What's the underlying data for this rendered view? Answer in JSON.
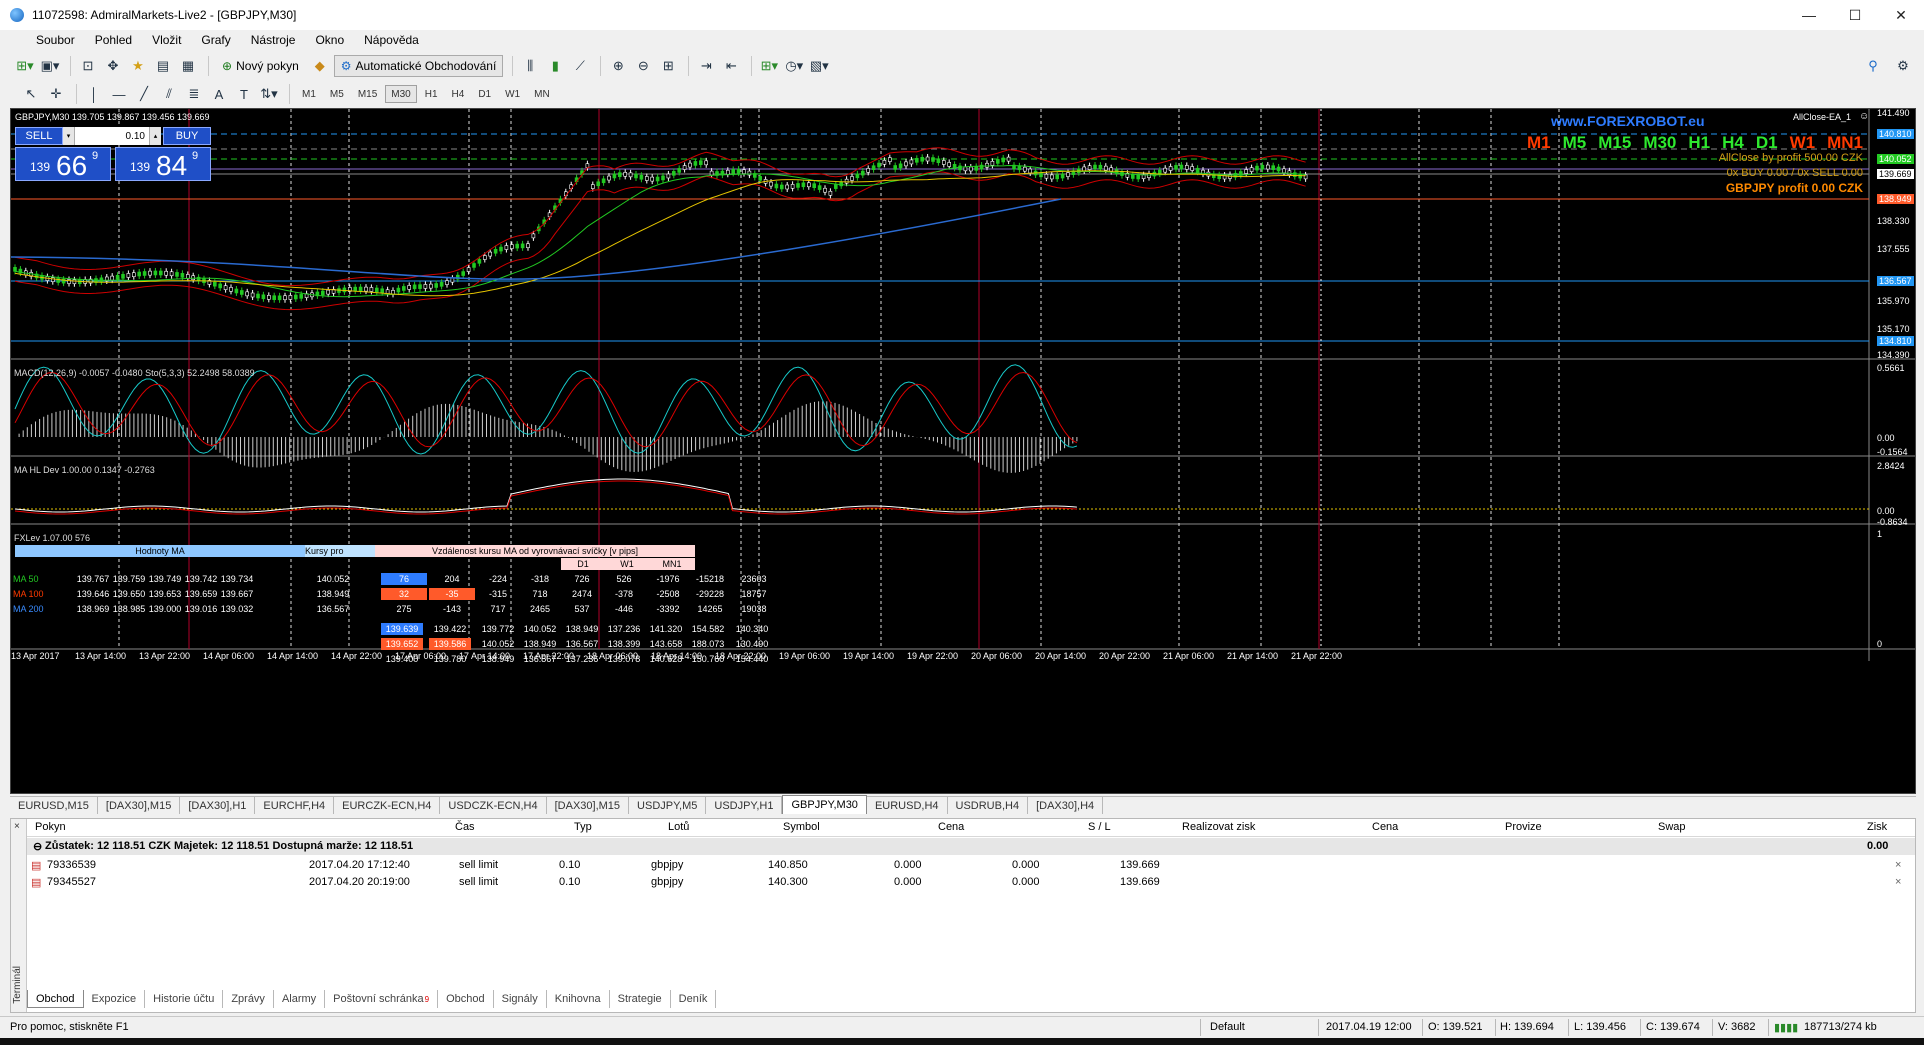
{
  "window": {
    "title": "11072598: AdmiralMarkets-Live2 - [GBPJPY,M30]",
    "controls": {
      "minimize": "—",
      "maximize": "☐",
      "close": "✕"
    }
  },
  "menu": [
    "Soubor",
    "Pohled",
    "Vložit",
    "Grafy",
    "Nástroje",
    "Okno",
    "Nápověda"
  ],
  "toolbar": {
    "new_order": "Nový pokyn",
    "auto_trading": "Automatické Obchodování",
    "timeframes": [
      "M1",
      "M5",
      "M15",
      "M30",
      "H1",
      "H4",
      "D1",
      "W1",
      "MN"
    ],
    "active_timeframe": "M30"
  },
  "chart": {
    "header": "GBPJPY,M30  139.705 139.867 139.456 139.669",
    "ea_label": "AllClose-EA_1",
    "site": "www.FOREXROBOT.eu",
    "oneclick": {
      "sell": "SELL",
      "buy": "BUY",
      "lot": "0.10",
      "bid_small": "139",
      "bid_big": "66",
      "bid_sup": "9",
      "ask_small": "139",
      "ask_big": "84",
      "ask_sup": "9"
    },
    "tf_strip": [
      "M1",
      "M5",
      "M15",
      "M30",
      "H1",
      "H4",
      "D1",
      "W1",
      "MN1"
    ],
    "tf_strip_colors": [
      "#ff3a00",
      "#2ee82e",
      "#2ee82e",
      "#2ee82e",
      "#2ee82e",
      "#2ee82e",
      "#2ee82e",
      "#ff3a00",
      "#ff3a00"
    ],
    "allclose_line1": "AllClose by profit 500.00 CZK",
    "allclose_line2": "0x BUY 0.00 / 0x SELL 0.00",
    "allclose_line3": "GBPJPY profit 0.00 CZK",
    "price_axis": [
      "141.490",
      "140.810",
      "140.052",
      "139.669",
      "138.949",
      "138.330",
      "137.555",
      "136.567",
      "135.970",
      "135.170",
      "134.810",
      "134.390"
    ],
    "macd_label": "MACD(12,26,9) -0.0057 -0.0480  Sto(5,3,3) 52.2498 58.0389",
    "macd_axis": [
      "0.5661",
      "0.00",
      "-0.1564"
    ],
    "mahl_label": "MA HL Dev 1.00.00 0.1347 -0.2763",
    "mahl_axis": [
      "2.8424",
      "0.00",
      "-0.8634"
    ],
    "fxlev_label": "FXLev 1.07.00 576",
    "fxlev_axis": [
      "1",
      "0"
    ],
    "time_axis": [
      "13 Apr 2017",
      "13 Apr 14:00",
      "13 Apr 22:00",
      "14 Apr 06:00",
      "14 Apr 14:00",
      "14 Apr 22:00",
      "17 Apr 06:00",
      "17 Apr 14:00",
      "17 Apr 22:00",
      "18 Apr 06:00",
      "18 Apr 14:00",
      "18 Apr 22:00",
      "19 Apr 06:00",
      "19 Apr 14:00",
      "19 Apr 22:00",
      "20 Apr 06:00",
      "20 Apr 14:00",
      "20 Apr 22:00",
      "21 Apr 06:00",
      "21 Apr 14:00",
      "21 Apr 22:00"
    ]
  },
  "fxlev": {
    "hdr_ma": "Hodnoty MA",
    "hdr_kurz": "Kursy pro",
    "hdr_vzd": "Vzdálenost kursu MA od vyrovnávací svíčky [v pips]",
    "hdr_d1": "D1",
    "hdr_w1": "W1",
    "hdr_mn1": "MN1",
    "rows": [
      {
        "name": "MA 50",
        "color": "#22c922",
        "vals": [
          "139.767",
          "139.759",
          "139.749",
          "139.742",
          "139.734"
        ],
        "kurz": "140.052",
        "c1": "76",
        "c2": "204",
        "d": [
          "-224",
          "-318",
          "726",
          "526",
          "-1976",
          "-15218",
          "23603"
        ]
      },
      {
        "name": "MA 100",
        "color": "#ff3a00",
        "vals": [
          "139.646",
          "139.650",
          "139.653",
          "139.659",
          "139.667"
        ],
        "kurz": "138.949",
        "c1": "32",
        "c2": "-35",
        "d": [
          "-315",
          "718",
          "2474",
          "-378",
          "-2508",
          "-29228",
          "18757"
        ]
      },
      {
        "name": "MA 200",
        "color": "#3a8cff",
        "vals": [
          "138.969",
          "138.985",
          "139.000",
          "139.016",
          "139.032"
        ],
        "kurz": "136.567",
        "c1": "275",
        "c2": "-143",
        "d": [
          "717",
          "2465",
          "537",
          "-446",
          "-3392",
          "14265",
          "19038"
        ]
      }
    ],
    "price_rows": [
      [
        "139.639",
        "139.422",
        "139.772",
        "140.052",
        "138.949",
        "137.236",
        "141.320",
        "154.582",
        "140.340"
      ],
      [
        "139.652",
        "139.586",
        "140.052",
        "138.949",
        "136.567",
        "138.399",
        "143.658",
        "188.073",
        "130.490"
      ],
      [
        "139.400",
        "139.780",
        "138.949",
        "136.567",
        "137.236",
        "139.078",
        "140.628",
        "150.760",
        "154.440"
      ]
    ]
  },
  "symbol_tabs": [
    "EURUSD,M15",
    "[DAX30],M15",
    "[DAX30],H1",
    "EURCHF,H4",
    "EURCZK-ECN,H4",
    "USDCZK-ECN,H4",
    "[DAX30],M15",
    "USDJPY,M5",
    "USDJPY,H1",
    "GBPJPY,M30",
    "EURUSD,H4",
    "USDRUB,H4",
    "[DAX30],H4"
  ],
  "active_symbol_tab": "GBPJPY,M30",
  "terminal": {
    "side_label": "Terminál",
    "headers": {
      "order": "Pokyn",
      "time": "Čas",
      "type": "Typ",
      "lots": "Lotů",
      "symbol": "Symbol",
      "price": "Cena",
      "sl": "S / L",
      "tp": "Realizovat zisk",
      "price2": "Cena",
      "commission": "Provize",
      "swap": "Swap",
      "profit": "Zisk"
    },
    "summary": "Zůstatek: 12 118.51 CZK  Majetek: 12 118.51  Dostupná marže: 12 118.51",
    "summary_profit": "0.00",
    "rows": [
      {
        "order": "79336539",
        "time": "2017.04.20 17:12:40",
        "type": "sell limit",
        "lots": "0.10",
        "symbol": "gbpjpy",
        "price": "140.850",
        "sl": "0.000",
        "tp": "0.000",
        "price2": "139.669"
      },
      {
        "order": "79345527",
        "time": "2017.04.20 20:19:00",
        "type": "sell limit",
        "lots": "0.10",
        "symbol": "gbpjpy",
        "price": "140.300",
        "sl": "0.000",
        "tp": "0.000",
        "price2": "139.669"
      }
    ],
    "tabs": [
      "Obchod",
      "Expozice",
      "Historie účtu",
      "Zprávy",
      "Alarmy",
      "Poštovní schránka",
      "Obchod",
      "Signály",
      "Knihovna",
      "Strategie",
      "Deník"
    ],
    "mail_badge": "9",
    "active_tab": "Obchod"
  },
  "status": {
    "help": "Pro pomoc, stiskněte F1",
    "profile": "Default",
    "datetime": "2017.04.19 12:00",
    "open": "O: 139.521",
    "high": "H: 139.694",
    "low": "L: 139.456",
    "close": "C: 139.674",
    "volume": "V: 3682",
    "traffic": "187713/274 kb"
  }
}
